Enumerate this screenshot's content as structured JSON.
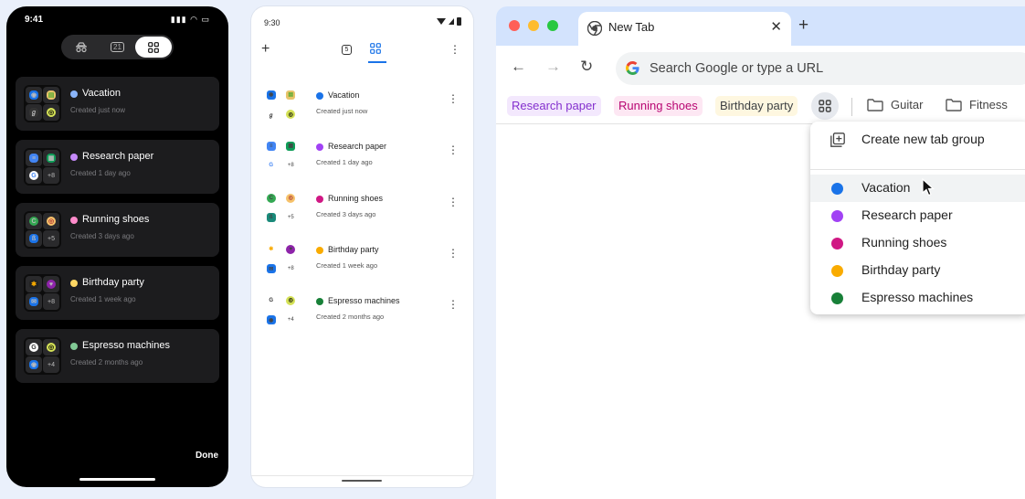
{
  "ios": {
    "time": "9:41",
    "status_icons": "▮▮▮ ◠ ▭",
    "segments": [
      "incognito",
      "21",
      "groups"
    ],
    "tab_count": "21",
    "groups": [
      {
        "title": "Vacation",
        "subtitle": "Created just now",
        "color": "#8ab4f8",
        "more": ""
      },
      {
        "title": "Research paper",
        "subtitle": "Created 1 day ago",
        "color": "#c58af9",
        "more": "+8"
      },
      {
        "title": "Running shoes",
        "subtitle": "Created 3 days ago",
        "color": "#ff8bcb",
        "more": "+5"
      },
      {
        "title": "Birthday party",
        "subtitle": "Created 1 week ago",
        "color": "#fdd663",
        "more": "+8"
      },
      {
        "title": "Espresso machines",
        "subtitle": "Created 2 months ago",
        "color": "#81c995",
        "more": "+4"
      }
    ],
    "done": "Done"
  },
  "android": {
    "time": "9:30",
    "tab_count": "5",
    "groups": [
      {
        "title": "Vacation",
        "subtitle": "Created just now",
        "color": "#1a73e8",
        "more": ""
      },
      {
        "title": "Research paper",
        "subtitle": "Created 1 day ago",
        "color": "#a142f4",
        "more": "+8"
      },
      {
        "title": "Running shoes",
        "subtitle": "Created 3 days ago",
        "color": "#d01884",
        "more": "+5"
      },
      {
        "title": "Birthday party",
        "subtitle": "Created 1 week ago",
        "color": "#f9ab00",
        "more": "+8"
      },
      {
        "title": "Espresso machines",
        "subtitle": "Created 2 months ago",
        "color": "#188038",
        "more": "+4"
      }
    ]
  },
  "chrome": {
    "tab_title": "New Tab",
    "omnibox_placeholder": "Search Google or type a URL",
    "bookmark_chips": [
      {
        "label": "Research paper",
        "bg": "#f3e8fd",
        "fg": "#8430ce"
      },
      {
        "label": "Running shoes",
        "bg": "#fde7f3",
        "fg": "#b80672"
      },
      {
        "label": "Birthday party",
        "bg": "#fef7e0",
        "fg": "#3c4043"
      }
    ],
    "folders": [
      "Guitar",
      "Fitness"
    ],
    "menu": {
      "create_label": "Create new tab group",
      "items": [
        {
          "label": "Vacation",
          "color": "#1a73e8"
        },
        {
          "label": "Research paper",
          "color": "#a142f4"
        },
        {
          "label": "Running shoes",
          "color": "#d01884"
        },
        {
          "label": "Birthday party",
          "color": "#f9ab00"
        },
        {
          "label": "Espresso machines",
          "color": "#188038"
        }
      ]
    }
  }
}
